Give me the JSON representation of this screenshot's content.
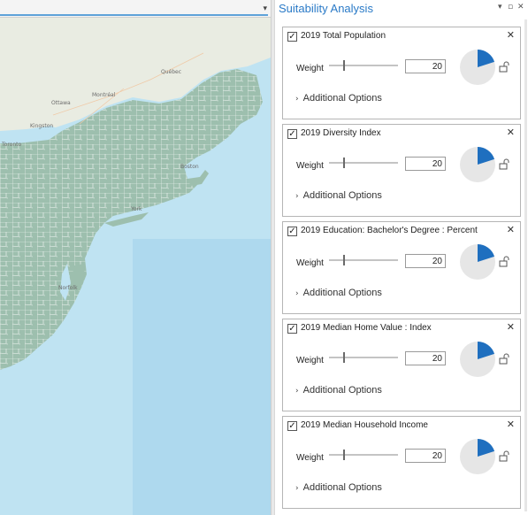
{
  "map": {
    "dropdown_arrow": "▾",
    "labels": [
      "Ottawa",
      "Montréal",
      "Kingston",
      "Boston",
      "York",
      "Norfolk",
      "Toronto",
      "Québec"
    ],
    "colors": {
      "water": "#bfe3f2",
      "land": "#e9ece2",
      "counties": "#9dbfae",
      "county_border": "#ffffff"
    }
  },
  "pane": {
    "title": "Suitability Analysis",
    "header_icons": {
      "dropdown": "chevron-down-icon",
      "restore": "restore-icon",
      "close": "close-icon"
    },
    "accent_color": "#2a7ac7"
  },
  "criteria": [
    {
      "title": "2019 Total Population",
      "checked": true,
      "weight_label": "Weight",
      "weight": "20",
      "share": 0.2,
      "options_label": "Additional Options"
    },
    {
      "title": "2019 Diversity Index",
      "checked": true,
      "weight_label": "Weight",
      "weight": "20",
      "share": 0.2,
      "options_label": "Additional Options"
    },
    {
      "title": "2019 Education: Bachelor's Degree : Percent",
      "checked": true,
      "weight_label": "Weight",
      "weight": "20",
      "share": 0.2,
      "options_label": "Additional Options"
    },
    {
      "title": "2019 Median Home Value : Index",
      "checked": true,
      "weight_label": "Weight",
      "weight": "20",
      "share": 0.2,
      "options_label": "Additional Options"
    },
    {
      "title": "2019 Median Household Income",
      "checked": true,
      "weight_label": "Weight",
      "weight": "20",
      "share": 0.2,
      "options_label": "Additional Options"
    }
  ],
  "pie_colors": {
    "filled": "#1f6fbf",
    "empty": "#e6e6e6"
  }
}
